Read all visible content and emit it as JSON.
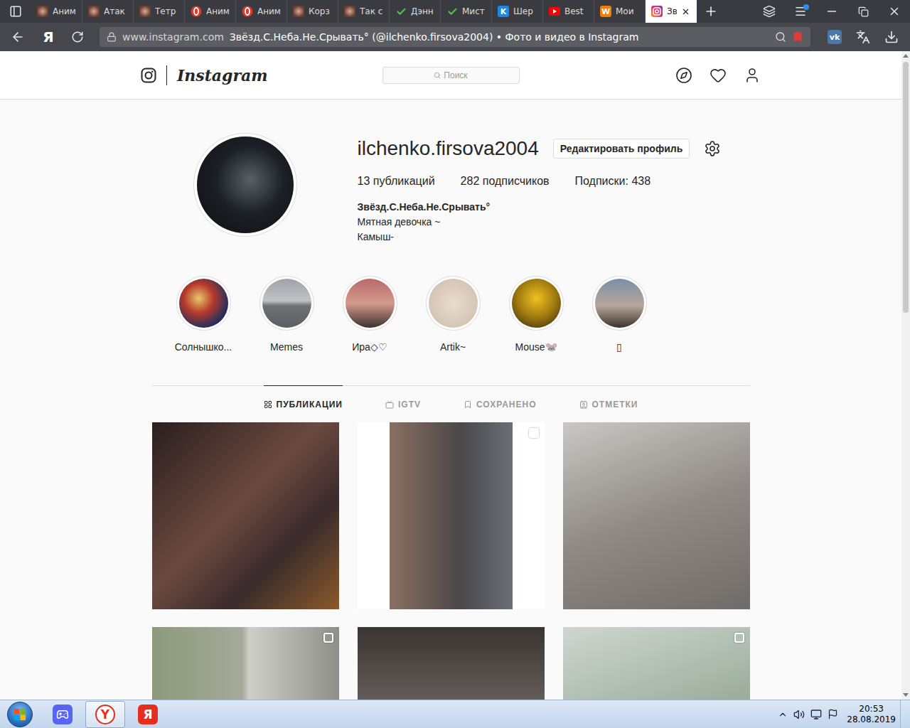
{
  "browser": {
    "tabs": [
      {
        "label": "Аним",
        "icon": "photo",
        "selected": false
      },
      {
        "label": "Атак",
        "icon": "photo",
        "selected": false
      },
      {
        "label": "Тетр",
        "icon": "photo",
        "selected": false
      },
      {
        "label": "Аним",
        "icon": "opera",
        "selected": false
      },
      {
        "label": "Аним",
        "icon": "opera",
        "selected": false
      },
      {
        "label": "Корз",
        "icon": "photo",
        "selected": false
      },
      {
        "label": "Так с",
        "icon": "photo",
        "selected": false
      },
      {
        "label": "Дэнн",
        "icon": "check",
        "selected": false
      },
      {
        "label": "Мист",
        "icon": "check",
        "selected": false
      },
      {
        "label": "Шер",
        "icon": "letter",
        "glyph": "K",
        "color": "#1e88e5",
        "selected": false
      },
      {
        "label": "Best",
        "icon": "youtube",
        "selected": false
      },
      {
        "label": "Мои",
        "icon": "letter",
        "glyph": "W",
        "color": "#f57c00",
        "selected": false
      },
      {
        "label": "Зв",
        "icon": "instagram",
        "selected": true
      }
    ],
    "yandex_button": "Я",
    "vk_button": "vk",
    "address": {
      "domain": "www.instagram.com",
      "title": "Звёзд.С.Неба.Не.Срывать° (@ilchenko.firsova2004) • Фото и видео в Instagram",
      "bookmarked": true
    }
  },
  "instagram": {
    "logo": "Instagram",
    "search": {
      "placeholder": "Поиск"
    },
    "profile": {
      "username": "ilchenko.firsova2004",
      "edit_button": "Редактировать профиль",
      "stats": [
        "13 публикаций",
        "282 подписчиков",
        "Подписки: 438"
      ],
      "name": "Звёзд.С.Неба.Не.Срывать°",
      "bio": [
        "Мятная девочка ~",
        "Камыш-"
      ]
    },
    "highlights": [
      {
        "label": "Солнышко..."
      },
      {
        "label": "Memes"
      },
      {
        "label": "Ира◇♡"
      },
      {
        "label": "Artik~"
      },
      {
        "label": "Mouse🐭"
      },
      {
        "label": "▯"
      }
    ],
    "profile_tabs": [
      {
        "label": "ПУБЛИКАЦИИ",
        "icon": "grid",
        "selected": true
      },
      {
        "label": "IGTV",
        "icon": "tv",
        "selected": false
      },
      {
        "label": "СОХРАНЕНО",
        "icon": "saved",
        "selected": false
      },
      {
        "label": "ОТМЕТКИ",
        "icon": "tagged",
        "selected": false
      }
    ],
    "posts": [
      {
        "multiple": false
      },
      {
        "multiple": true
      },
      {
        "multiple": false
      },
      {
        "multiple": true
      },
      {
        "multiple": false
      },
      {
        "multiple": true
      }
    ]
  },
  "taskbar": {
    "apps": [
      {
        "kind": "discord",
        "glyph": "",
        "selected": false
      },
      {
        "kind": "yandex",
        "glyph": "Y",
        "selected": true
      },
      {
        "kind": "yandex-alt",
        "glyph": "Я",
        "selected": false
      }
    ],
    "time": "20:53",
    "date": "28.08.2019"
  }
}
